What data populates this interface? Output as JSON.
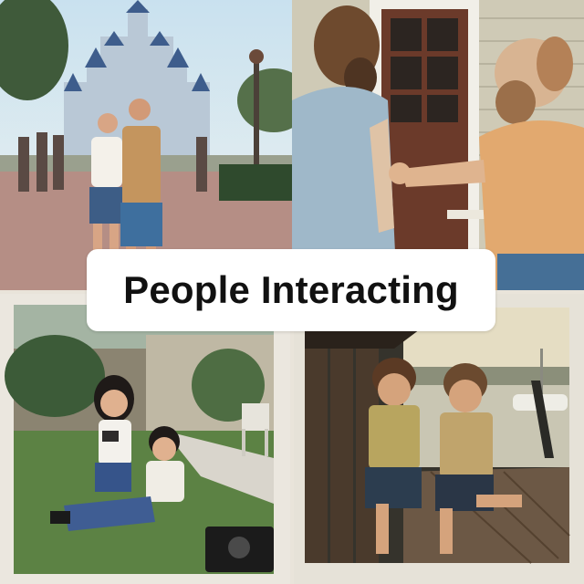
{
  "caption": {
    "text": "People Interacting"
  },
  "photos": [
    {
      "subject": "Couple posing in front of a fairytale castle"
    },
    {
      "subject": "Two bearded men talking by a house door"
    },
    {
      "subject": "Two children sitting on a backyard lawn with a camera"
    },
    {
      "subject": "Two boys sitting on a wooden dock by the water"
    }
  ],
  "colors": {
    "caption_bg": "#ffffff",
    "caption_text": "#111111"
  }
}
